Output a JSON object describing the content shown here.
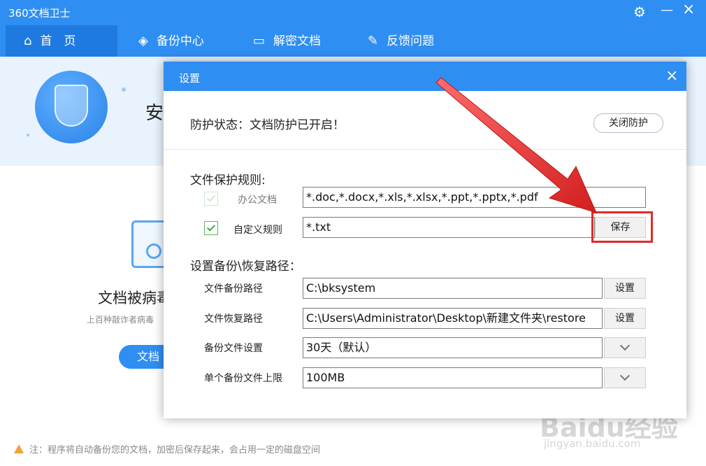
{
  "app": {
    "title": "360文档卫士"
  },
  "nav": {
    "items": [
      {
        "label": "首　页",
        "icon": "home-icon"
      },
      {
        "label": "备份中心",
        "icon": "layers-icon"
      },
      {
        "label": "解密文档",
        "icon": "folder-icon"
      },
      {
        "label": "反馈问题",
        "icon": "edit-icon"
      }
    ]
  },
  "hero": {
    "text": "安"
  },
  "middle": {
    "title": "文档被病毒",
    "subtitle": "上百种敲诈者病毒",
    "button": "文档"
  },
  "footer": {
    "note": "注：程序将自动备份您的文档，加密后保存起来，会占用一定的磁盘空间"
  },
  "dialog": {
    "title": "设置",
    "status": "防护状态：文档防护已开启！",
    "close_protect": "关闭防护",
    "rules_label": "文件保护规则:",
    "office_label": "办公文档",
    "office_value": "*.doc,*.docx,*.xls,*.xlsx,*.ppt,*.pptx,*.pdf",
    "custom_label": "自定义规则",
    "custom_value": "*.txt",
    "save": "保存",
    "path_label": "设置备份\\恢复路径：",
    "backup_path_label": "文件备份路径",
    "backup_path_value": "C:\\bksystem",
    "restore_path_label": "文件恢复路径",
    "restore_path_value": "C:\\Users\\Administrator\\Desktop\\新建文件夹\\restore",
    "set_button": "设置",
    "backup_setting_label": "备份文件设置",
    "backup_setting_value": "30天（默认）",
    "limit_label": "单个备份文件上限",
    "limit_value": "100MB"
  },
  "annotation": {
    "arrow_color": "#e12a2a",
    "highlight_color": "#e12a2a"
  },
  "watermark": {
    "logo": "Baidu经验",
    "url": "jingyan.baidu.com"
  }
}
